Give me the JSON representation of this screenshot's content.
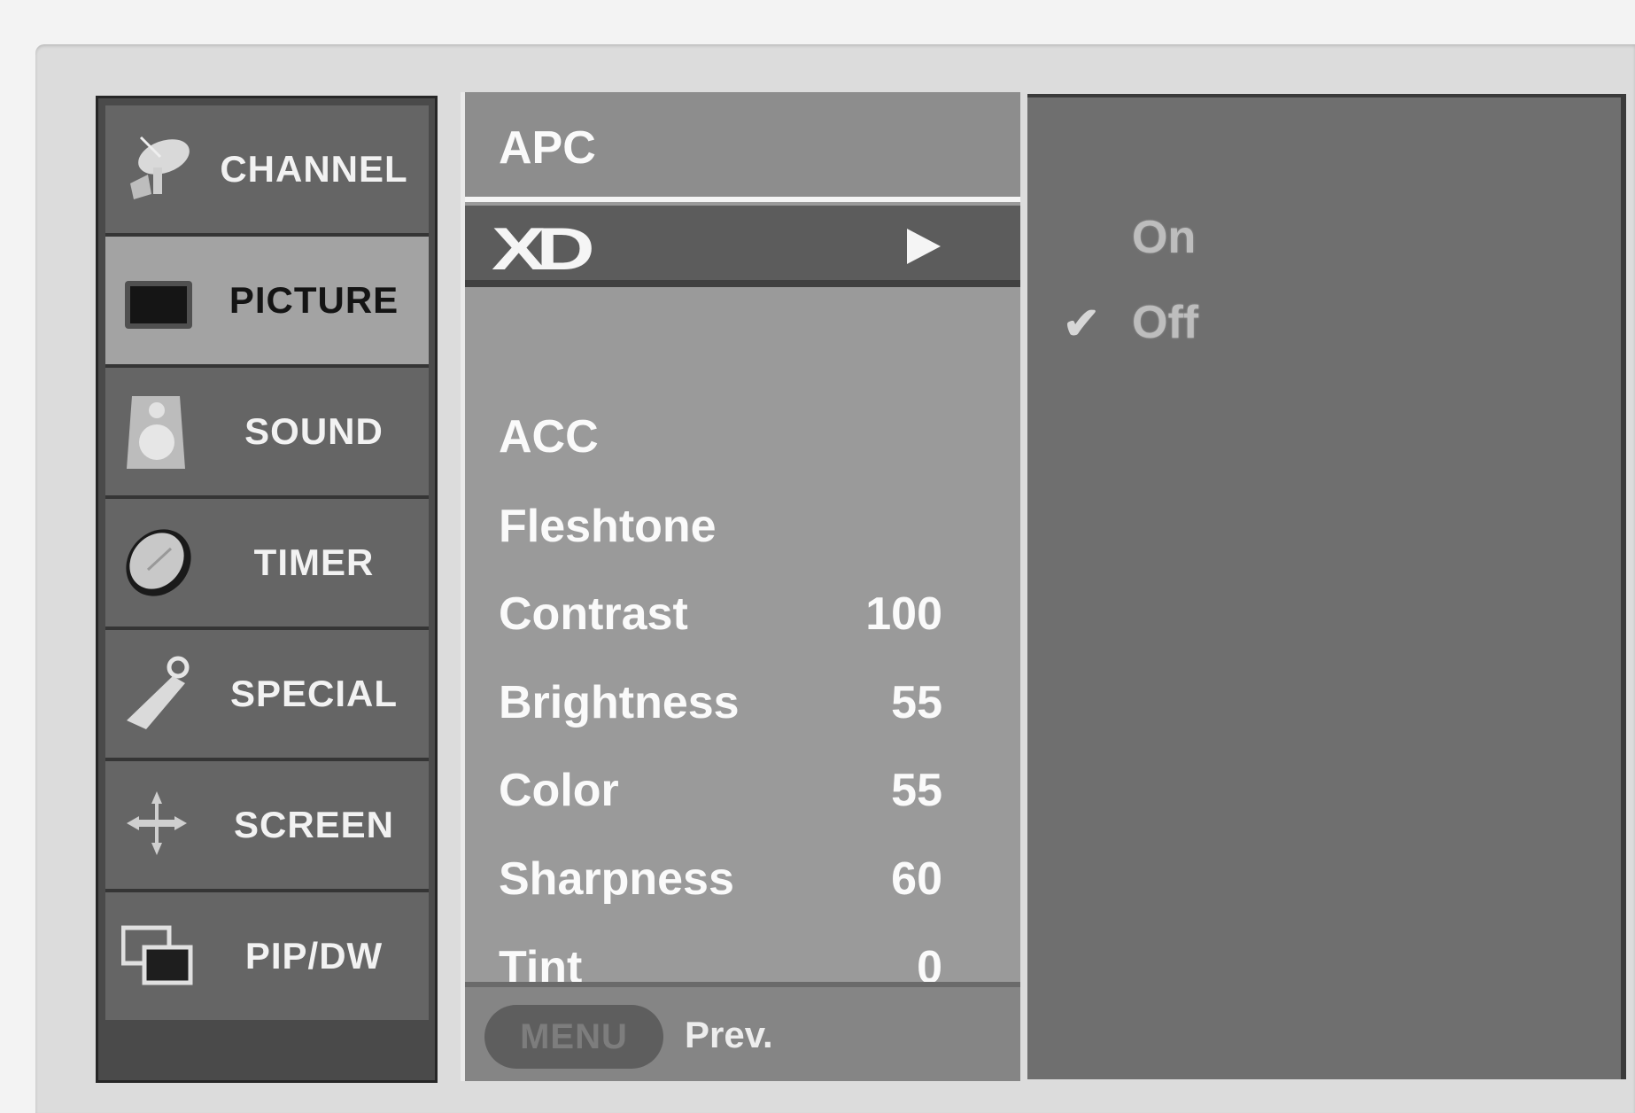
{
  "categories": [
    {
      "label": "CHANNEL",
      "icon": "satellite-dish-icon",
      "selected": false
    },
    {
      "label": "PICTURE",
      "icon": "tv-screen-icon",
      "selected": true
    },
    {
      "label": "SOUND",
      "icon": "speaker-icon",
      "selected": false
    },
    {
      "label": "TIMER",
      "icon": "clock-icon",
      "selected": false
    },
    {
      "label": "SPECIAL",
      "icon": "key-tag-icon",
      "selected": false
    },
    {
      "label": "SCREEN",
      "icon": "move-arrows-icon",
      "selected": false
    },
    {
      "label": "PIP/DW",
      "icon": "pip-windows-icon",
      "selected": false
    }
  ],
  "picture_menu": {
    "apc": "APC",
    "xd": "XD",
    "items": [
      {
        "label": "ACC",
        "value": ""
      },
      {
        "label": "Fleshtone",
        "value": ""
      },
      {
        "label": "Contrast",
        "value": "100"
      },
      {
        "label": "Brightness",
        "value": "55"
      },
      {
        "label": "Color",
        "value": "55"
      },
      {
        "label": "Sharpness",
        "value": "60"
      },
      {
        "label": "Tint",
        "value": "0"
      }
    ]
  },
  "xd_options": {
    "on": "On",
    "off": "Off",
    "selected": "Off"
  },
  "footer": {
    "menu_button": "MENU",
    "prev": "Prev."
  },
  "colors": {
    "selected_category": "#a3a3a3",
    "category": "#656565",
    "submenu": "#9a9a9a",
    "xd_highlight": "#5c5c5c",
    "options_panel": "#6f6f6f"
  }
}
